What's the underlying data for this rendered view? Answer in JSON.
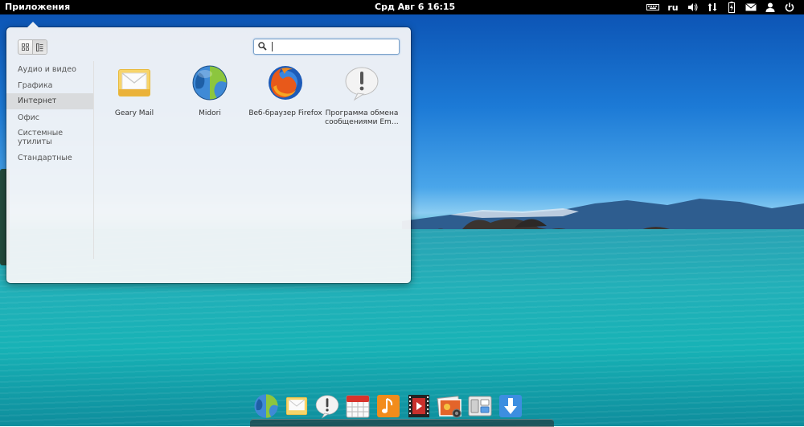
{
  "top_panel": {
    "apps_label": "Приложения",
    "clock": "Срд Авг  6 16:15",
    "keyboard_layout": "ru",
    "indicators": [
      "keyboard-icon",
      "keyboard-layout",
      "volume-icon",
      "network-icon",
      "battery-icon",
      "mail-icon",
      "user-icon",
      "power-icon"
    ]
  },
  "app_menu": {
    "search": {
      "value": "",
      "placeholder": ""
    },
    "view_modes": [
      "grid-view-icon",
      "category-view-icon"
    ],
    "active_view": "category-view-icon",
    "categories": [
      {
        "label": "Аудио и видео",
        "selected": false
      },
      {
        "label": "Графика",
        "selected": false
      },
      {
        "label": "Интернет",
        "selected": true
      },
      {
        "label": "Офис",
        "selected": false
      },
      {
        "label": "Системные\nутилиты",
        "selected": false
      },
      {
        "label": "Стандартные",
        "selected": false
      }
    ],
    "apps": [
      {
        "name": "Geary Mail",
        "icon": "mail-envelope-icon"
      },
      {
        "name": "Midori",
        "icon": "midori-globe-icon"
      },
      {
        "name": "Веб-браузер Firefox",
        "icon": "firefox-icon"
      },
      {
        "name": "Программа обмена\nсообщениями Em…",
        "icon": "speech-bubble-icon"
      }
    ]
  },
  "dock": {
    "items": [
      "midori-icon",
      "mail-icon",
      "messaging-icon",
      "calendar-icon",
      "music-icon",
      "video-icon",
      "photos-icon",
      "switchboard-icon",
      "software-update-icon"
    ]
  },
  "colors": {
    "panel": "#000000",
    "accent": "#4a90d9",
    "popover_bg": "#f6f7f8",
    "selected_category": "#d9dbdd"
  }
}
